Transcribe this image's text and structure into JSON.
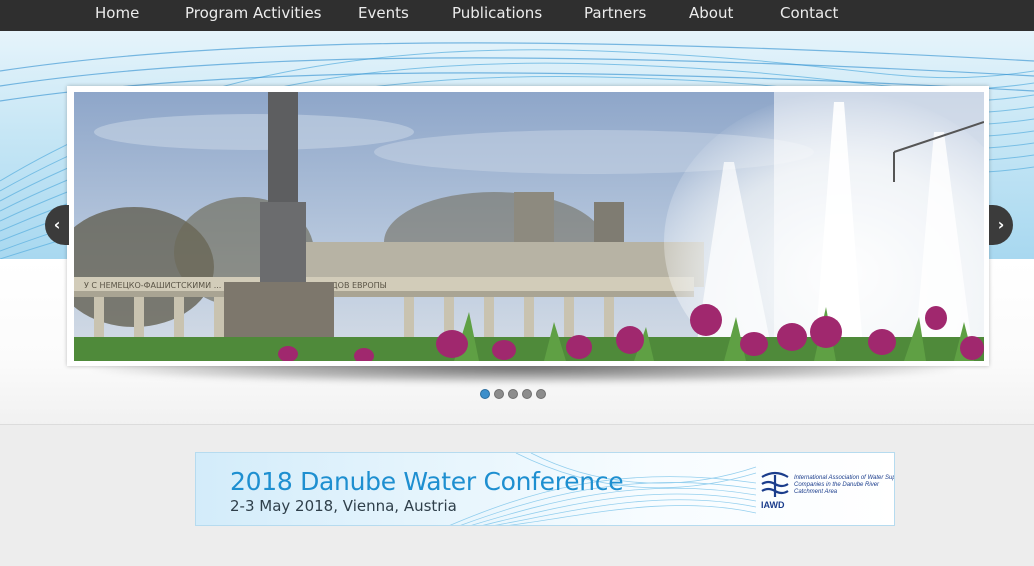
{
  "nav": {
    "items": [
      {
        "label": "Home"
      },
      {
        "label": "Program Activities"
      },
      {
        "label": "Events"
      },
      {
        "label": "Publications"
      },
      {
        "label": "Partners"
      },
      {
        "label": "About"
      },
      {
        "label": "Contact"
      }
    ]
  },
  "slider": {
    "prev_icon": "chevron-left-icon",
    "next_icon": "chevron-right-icon",
    "prev_glyph": "‹",
    "next_glyph": "›",
    "slide_count": 5,
    "active_slide": 1,
    "inscription": "У С НЕМЕЦКО-ФАШИСТСКИМИ ... И НЕЗАВИСИМОСТЬ НАРОДОВ ЕВРОПЫ"
  },
  "banner": {
    "title": "2018 Danube Water Conference",
    "subtitle": "2-3 May 2018, Vienna, Austria",
    "logo_label": "IAWD",
    "logo_text": "International Association of Water Supply Companies in the Danube River Catchment Area",
    "title_color": "#1e8fd0",
    "logo_color": "#1b3d8c"
  },
  "colors": {
    "nav_bg": "#2f2f2f",
    "accent": "#3d8fcb"
  }
}
